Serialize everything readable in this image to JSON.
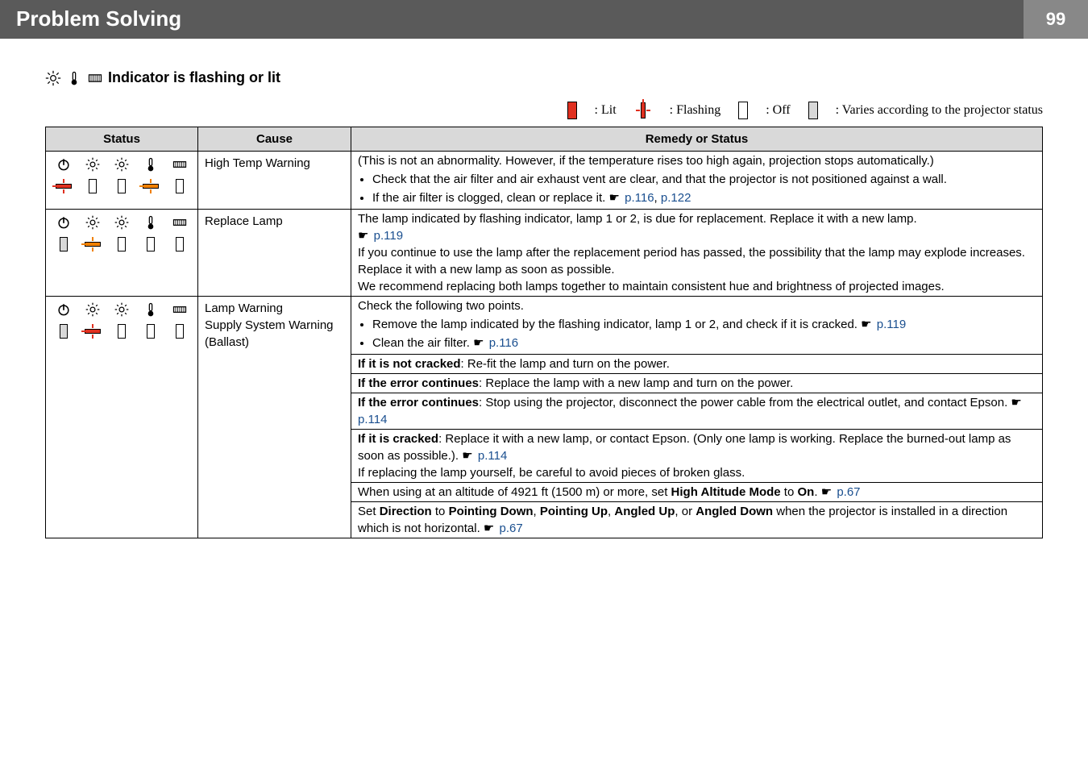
{
  "header": {
    "title": "Problem Solving",
    "page_number": "99"
  },
  "section": {
    "heading": "Indicator is flashing or lit"
  },
  "legend": {
    "lit": ": Lit",
    "flashing": ": Flashing",
    "off": ": Off",
    "varies": ": Varies according to the projector status"
  },
  "table": {
    "headers": {
      "status": "Status",
      "cause": "Cause",
      "remedy": "Remedy or Status"
    },
    "rows": [
      {
        "cause": "High Temp Warning",
        "remedy_cells": [
          {
            "items": [
              {
                "text": "(This is not an abnormality. However, if the temperature rises too high again, projection stops automatically.)"
              },
              {
                "bullet": true,
                "text": "Check that the air filter and air exhaust vent are clear, and that the projector is not positioned against a wall."
              },
              {
                "bullet": true,
                "text": "If the air filter is clogged, clean or replace it. ",
                "links": [
                  "p.116",
                  "p.122"
                ]
              }
            ]
          }
        ]
      },
      {
        "cause": "Replace Lamp",
        "remedy_cells": [
          {
            "items": [
              {
                "text": "The lamp indicated by flashing indicator, lamp 1 or 2, is due for replacement. Replace it with a new lamp. ",
                "links": [
                  "p.119"
                ],
                "link_newline": true
              },
              {
                "text": "If you continue to use the lamp after the replacement period has passed, the possibility that the lamp may explode increases. Replace it with a new lamp as soon as possible."
              },
              {
                "text": "We recommend replacing both lamps together to maintain consistent hue and brightness of projected images."
              }
            ]
          }
        ]
      },
      {
        "cause_multi": [
          "Lamp Warning",
          "Supply System Warning (Ballast)"
        ],
        "remedy_cells": [
          {
            "items": [
              {
                "text": "Check the following two points."
              },
              {
                "bullet": true,
                "text": "Remove the lamp indicated by the flashing indicator, lamp 1 or 2, and check if it is cracked. ",
                "links": [
                  "p.119"
                ]
              },
              {
                "bullet": true,
                "text": "Clean the air filter. ",
                "links": [
                  "p.116"
                ]
              }
            ]
          },
          {
            "items": [
              {
                "html_prefix_bold": "If it is not cracked",
                "text": ": Re-fit the lamp and turn on the power."
              }
            ]
          },
          {
            "items": [
              {
                "html_prefix_bold": "If the error continues",
                "text": ": Replace the lamp with a new lamp and turn on the power."
              }
            ]
          },
          {
            "items": [
              {
                "html_prefix_bold": "If the error continues",
                "text": ": Stop using the projector, disconnect the power cable from the electrical outlet, and contact Epson. ",
                "links": [
                  "p.114"
                ]
              }
            ]
          },
          {
            "items": [
              {
                "html_prefix_bold": "If it is cracked",
                "text": ": Replace it with a new lamp, or contact Epson. (Only one lamp is working. Replace the burned-out lamp as soon as possible.). ",
                "links": [
                  "p.114"
                ]
              },
              {
                "text": "If replacing the lamp yourself, be careful to avoid pieces of broken glass."
              }
            ]
          },
          {
            "items": [
              {
                "text": "When using at an altitude of 4921 ft (1500 m) or more, set ",
                "bold_inline": "High Altitude Mode",
                "text2": " to ",
                "bold_inline2": "On",
                "text3": ". ",
                "links": [
                  "p.67"
                ]
              }
            ]
          },
          {
            "items": [
              {
                "text": "Set ",
                "bold_inline": "Direction",
                "text2": " to ",
                "bold_inline2": "Pointing Down",
                "text3": ", ",
                "bold_inline3": "Pointing Up",
                "text4": ", ",
                "bold_inline4": "Angled Up",
                "text5": ", or ",
                "bold_inline5": "Angled Down",
                "text6": " when the projector is installed in a direction which is not horizontal. ",
                "links": [
                  "p.67"
                ]
              }
            ]
          }
        ]
      }
    ]
  },
  "icons": {
    "power": "⏻",
    "sun_small": "☼",
    "sun_big": "☀",
    "therm": "🌡",
    "filter": "▥"
  },
  "link_separator": ", "
}
